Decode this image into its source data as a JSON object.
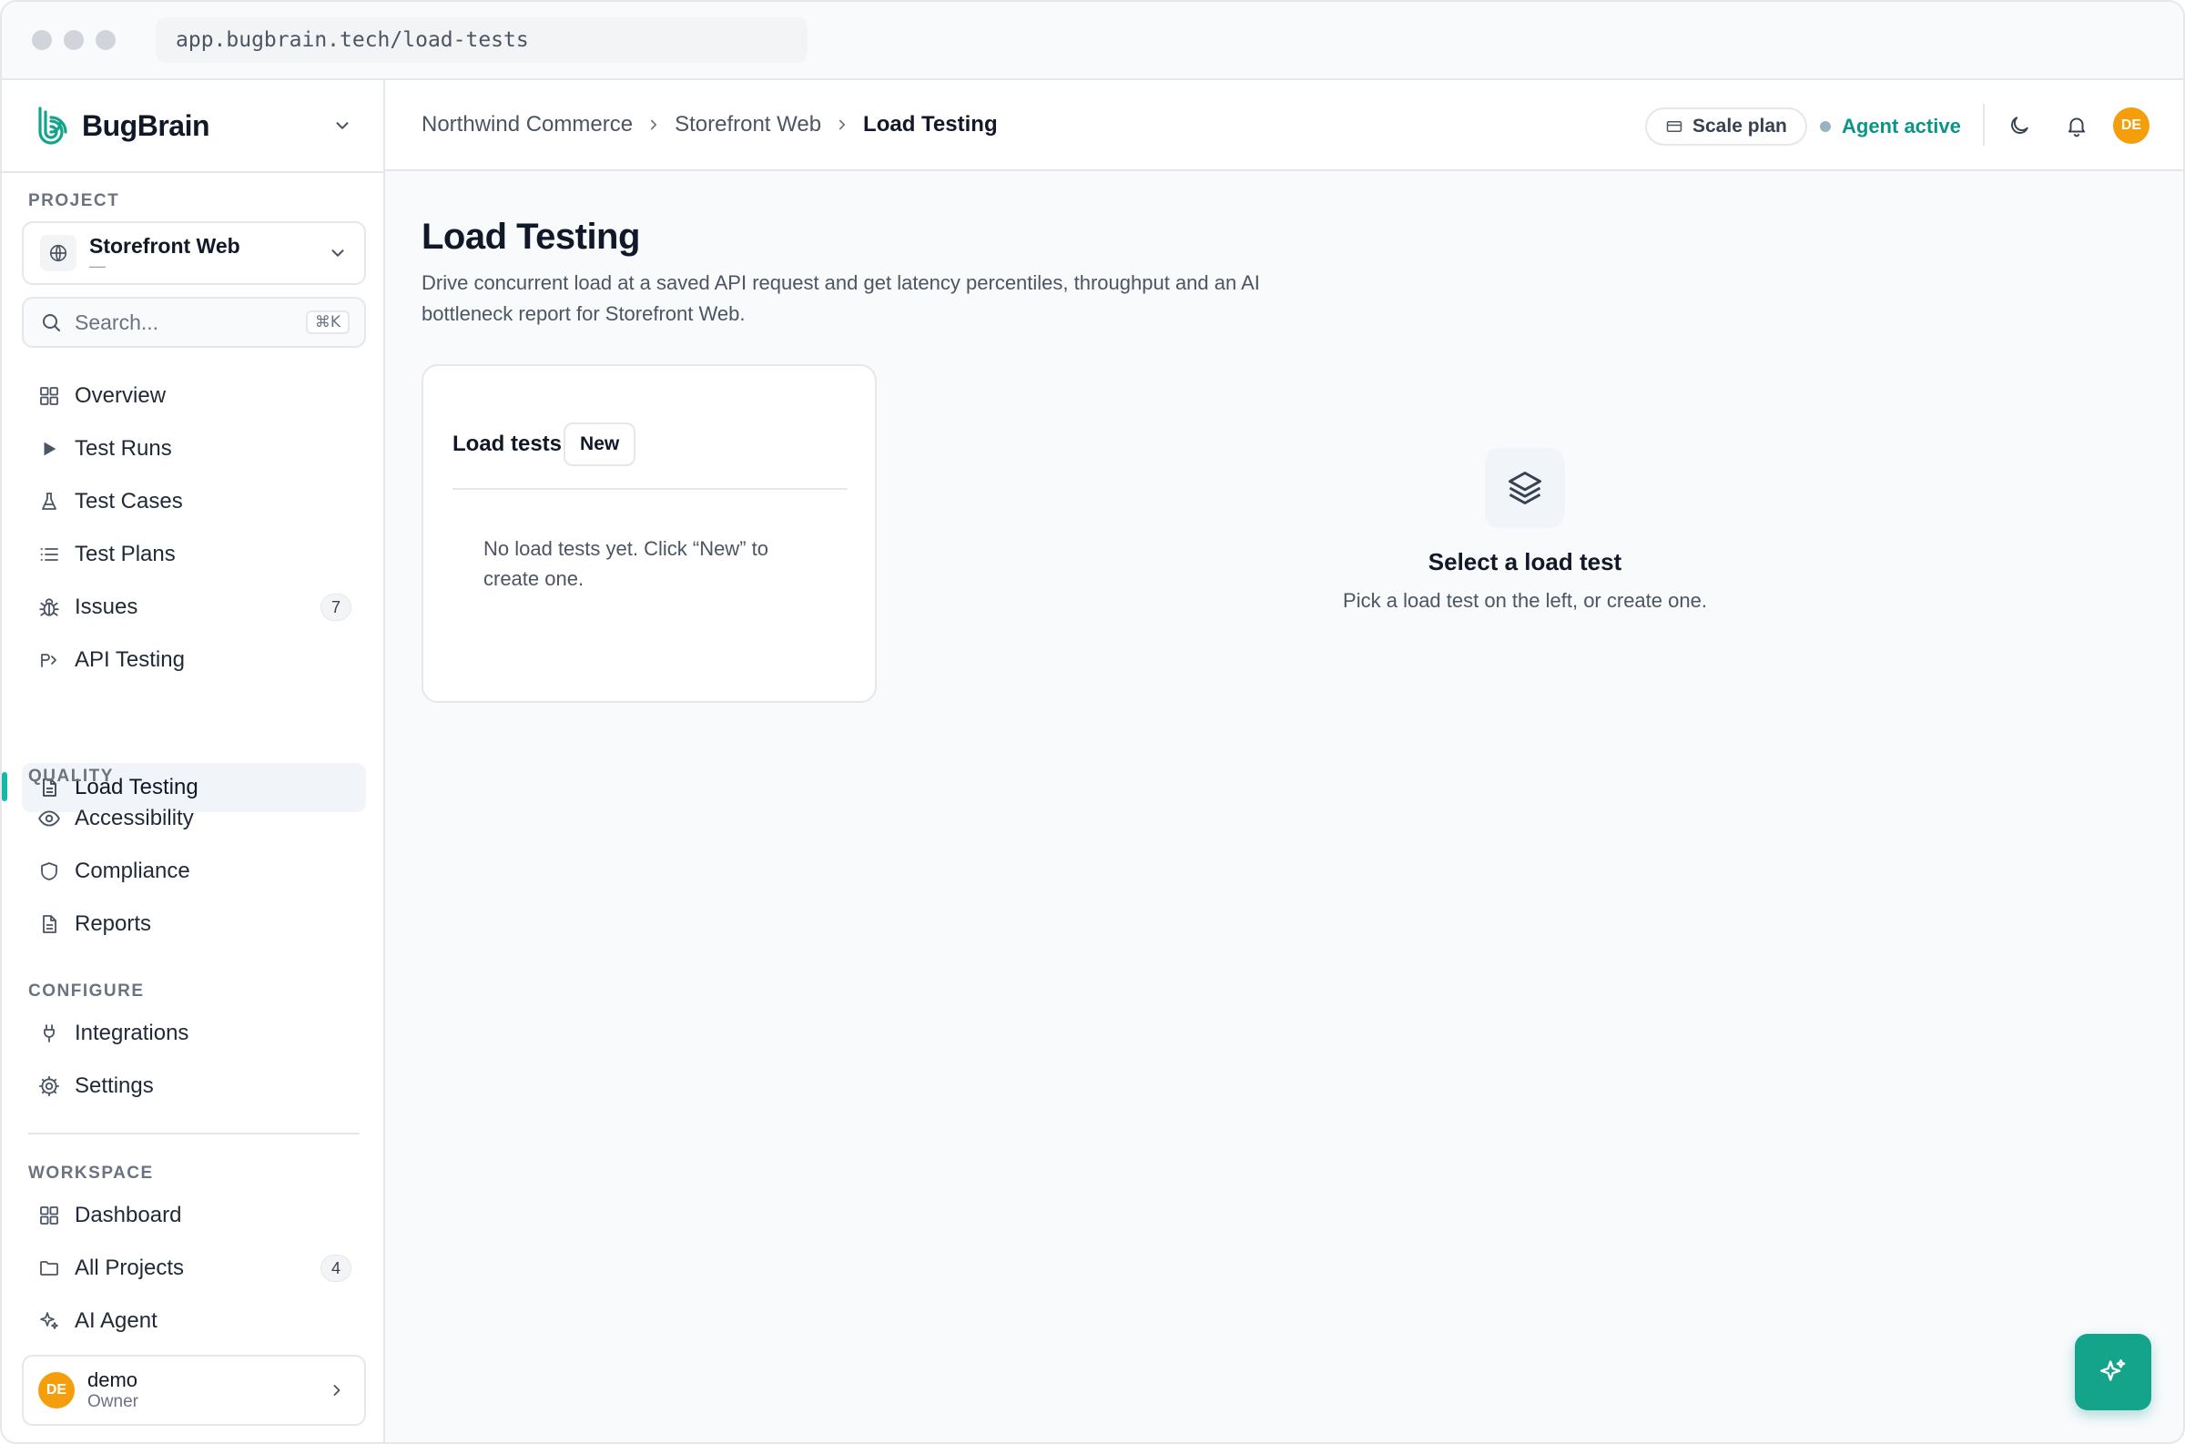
{
  "browser": {
    "url": "app.bugbrain.tech/load-tests"
  },
  "brand": {
    "name": "BugBrain",
    "accent": "#14b8a6"
  },
  "sidebar": {
    "project_label": "PROJECT",
    "project": {
      "name": "Storefront Web",
      "sub": "—"
    },
    "search": {
      "placeholder": "Search...",
      "shortcut": "⌘K"
    },
    "main_items": [
      {
        "label": "Overview",
        "icon": "grid-icon"
      },
      {
        "label": "Test Runs",
        "icon": "play-icon"
      },
      {
        "label": "Test Cases",
        "icon": "flask-icon"
      },
      {
        "label": "Test Plans",
        "icon": "list-icon"
      },
      {
        "label": "Issues",
        "icon": "bug-icon",
        "count": "7"
      },
      {
        "label": "API Testing",
        "icon": "api-icon"
      },
      {
        "label": "Load Testing",
        "icon": "document-icon",
        "active": true
      }
    ],
    "quality_label": "QUALITY",
    "quality_items": [
      {
        "label": "Accessibility",
        "icon": "eye-icon"
      },
      {
        "label": "Compliance",
        "icon": "shield-icon"
      },
      {
        "label": "Reports",
        "icon": "report-icon"
      }
    ],
    "configure_label": "CONFIGURE",
    "configure_items": [
      {
        "label": "Integrations",
        "icon": "plug-icon"
      },
      {
        "label": "Settings",
        "icon": "gear-icon"
      }
    ],
    "workspace_label": "WORKSPACE",
    "workspace_items": [
      {
        "label": "Dashboard",
        "icon": "grid-icon"
      },
      {
        "label": "All Projects",
        "icon": "folder-icon",
        "count": "4"
      },
      {
        "label": "AI Agent",
        "icon": "sparkle-icon"
      }
    ],
    "user": {
      "initials": "DE",
      "name": "demo",
      "role": "Owner"
    }
  },
  "topbar": {
    "breadcrumbs": [
      "Northwind Commerce",
      "Storefront Web",
      "Load Testing"
    ],
    "plan": "Scale plan",
    "agent_status": "Agent active",
    "avatar_initials": "DE"
  },
  "main": {
    "title": "Load Testing",
    "description": "Drive concurrent load at a saved API request and get latency percentiles, throughput and an AI bottleneck report for Storefront Web.",
    "card": {
      "title": "Load tests",
      "new_button": "New",
      "empty_text": "No load tests yet. Click “New” to create one."
    },
    "empty_state": {
      "title": "Select a load test",
      "subtitle": "Pick a load test on the left, or create one."
    }
  }
}
